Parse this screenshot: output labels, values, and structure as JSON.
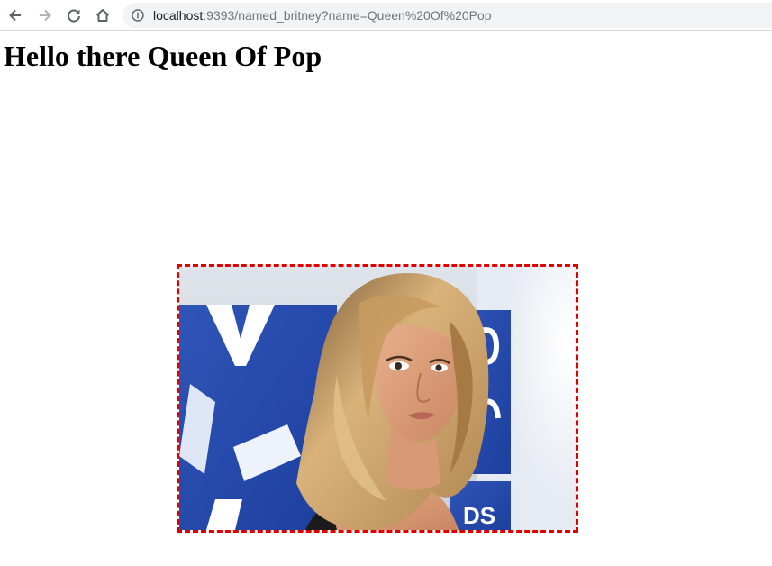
{
  "browser": {
    "url_host": "localhost",
    "url_rest": ":9393/named_britney?name=Queen%20Of%20Pop",
    "nav_icons": [
      "back-arrow-icon",
      "forward-arrow-icon",
      "reload-icon",
      "home-icon",
      "info-icon"
    ]
  },
  "page": {
    "heading": "Hello there Queen Of Pop",
    "image_icon": "portrait-photo",
    "frame_border_color": "#e00000"
  }
}
